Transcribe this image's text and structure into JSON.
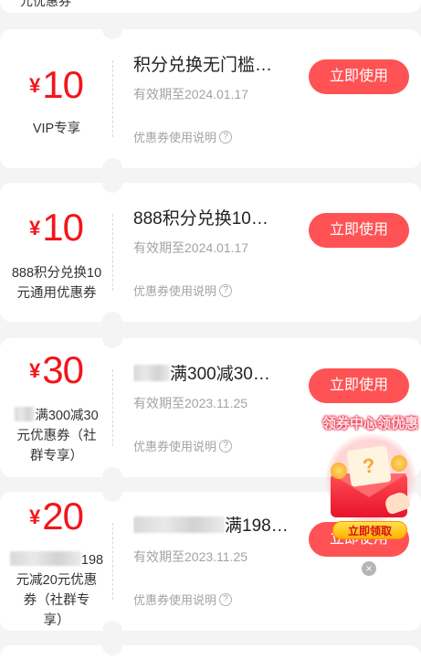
{
  "top_strip": {
    "partial_text": "元优惠券"
  },
  "coupons": [
    {
      "currency": "¥",
      "amount": "10",
      "left_desc": "VIP专享",
      "title": "积分兑换无门槛…",
      "expiry": "有效期至2024.01.17",
      "help": "优惠券使用说明",
      "button": "立即使用"
    },
    {
      "currency": "¥",
      "amount": "10",
      "left_desc_line1": "888积分兑换10",
      "left_desc_line2": "元通用优惠券",
      "title": "888积分兑换10…",
      "expiry": "有效期至2024.01.17",
      "help": "优惠券使用说明",
      "button": "立即使用"
    },
    {
      "currency": "¥",
      "amount": "30",
      "left_desc_line1_suffix": "满300减30",
      "left_desc_line2": "元优惠券（社",
      "left_desc_line3": "群专享）",
      "title_suffix": "满300减30…",
      "expiry": "有效期至2023.11.25",
      "help": "优惠券使用说明",
      "button": "立即使用"
    },
    {
      "currency": "¥",
      "amount": "20",
      "left_desc_line1_suffix": "198",
      "left_desc_line2": "元减20元优惠",
      "left_desc_line3": "券（社群专",
      "left_desc_line4": "享）",
      "title_suffix": "满198…",
      "expiry": "有效期至2023.11.25",
      "help": "优惠券使用说明",
      "button": "立即使用"
    }
  ],
  "promo": {
    "title": "领券中心领优惠",
    "button": "立即领取",
    "close": "×"
  },
  "icons": {
    "help": "?"
  },
  "colors": {
    "price_red": "#f2151b",
    "button_red": "#fe5254",
    "page_bg": "#f4f4f4"
  }
}
